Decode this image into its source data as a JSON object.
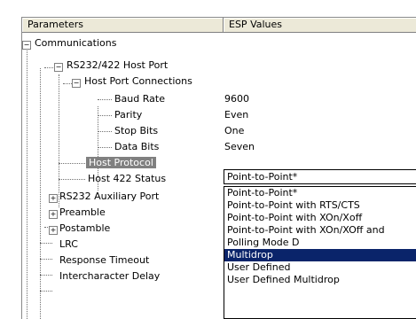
{
  "columns": {
    "param": "Parameters",
    "value": "ESP Values"
  },
  "tree": {
    "communications": "Communications",
    "rs232_host_port": "RS232/422 Host Port",
    "host_port_connections": "Host Port Connections",
    "baud_rate": {
      "label": "Baud Rate",
      "value": "9600"
    },
    "parity": {
      "label": "Parity",
      "value": "Even"
    },
    "stop_bits": {
      "label": "Stop Bits",
      "value": "One"
    },
    "data_bits": {
      "label": "Data Bits",
      "value": "Seven"
    },
    "host_protocol": {
      "label": "Host Protocol",
      "value": "Point-to-Point*"
    },
    "host_422_status": "Host 422 Status",
    "rs232_aux_port": "RS232 Auxiliary Port",
    "preamble": "Preamble",
    "postamble": "Postamble",
    "lrc": "LRC",
    "response_timeout": "Response Timeout",
    "intercharacter_delay": "Intercharacter Delay"
  },
  "dropdown": {
    "selected": "Point-to-Point*",
    "options": [
      "Point-to-Point*",
      "Point-to-Point with RTS/CTS",
      "Point-to-Point with XOn/Xoff",
      "Point-to-Point with XOn/XOff and",
      "Polling Mode D",
      "Multidrop",
      "User Defined",
      "User Defined Multidrop"
    ],
    "highlighted_index": 5
  },
  "colors": {
    "highlight": "#0a246a",
    "selection": "#808080",
    "header": "#ece9d8"
  }
}
